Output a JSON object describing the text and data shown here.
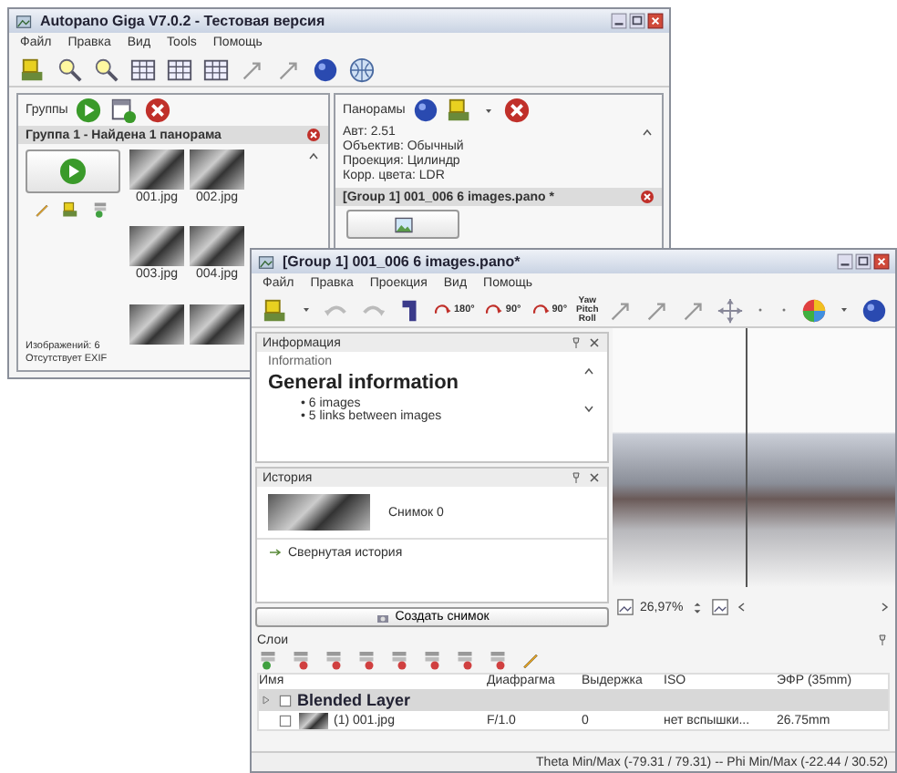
{
  "main_window": {
    "title": "Autopano Giga V7.0.2 - Тестовая версия",
    "menu": [
      "Файл",
      "Правка",
      "Вид",
      "Tools",
      "Помощь"
    ],
    "groups_panel": {
      "label": "Группы",
      "group_header": "Группа 1 - Найдена 1 панорама",
      "images": [
        {
          "name": "001.jpg"
        },
        {
          "name": "002.jpg"
        },
        {
          "name": "003.jpg"
        },
        {
          "name": "004.jpg"
        }
      ],
      "info": [
        "Изображений: 6",
        "Отсутствует EXIF"
      ]
    },
    "panoramas_panel": {
      "label": "Панорамы",
      "details": [
        "Авт: 2.51",
        "Объектив: Обычный",
        "Проекция: Цилиндр",
        "Корр. цвета: LDR"
      ],
      "pano_header": "[Group 1] 001_006 6 images.pano *"
    }
  },
  "editor_window": {
    "title": "[Group 1] 001_006 6 images.pano*",
    "menu": [
      "Файл",
      "Правка",
      "Проекция",
      "Вид",
      "Помощь"
    ],
    "toolbar_labels": [
      "180°",
      "90°",
      "90°",
      "Yaw Pitch Roll"
    ],
    "info_panel": {
      "label": "Информация",
      "subtitle": "Information",
      "heading": "General information",
      "bullets": [
        "• 6 images",
        "• 5 links between images"
      ]
    },
    "history_panel": {
      "label": "История",
      "snapshot": "Снимок 0",
      "collapsed": "Свернутая история",
      "create_button": "Создать снимок"
    },
    "zoom": "26,97%",
    "layers_panel": {
      "label": "Слои",
      "columns": [
        "Имя",
        "Диафрагма",
        "Выдержка",
        "ISO",
        "ЭФР (35mm)"
      ],
      "rows": [
        {
          "name": "Blended Layer",
          "cells": [],
          "children": [
            {
              "name": "(1) 001.jpg",
              "cells": [
                "F/1.0",
                "0",
                "нет вспышки...",
                "26.75mm"
              ]
            }
          ]
        }
      ]
    },
    "status": "Theta Min/Max (-79.31 / 79.31) -- Phi Min/Max (-22.44 / 30.52)"
  }
}
